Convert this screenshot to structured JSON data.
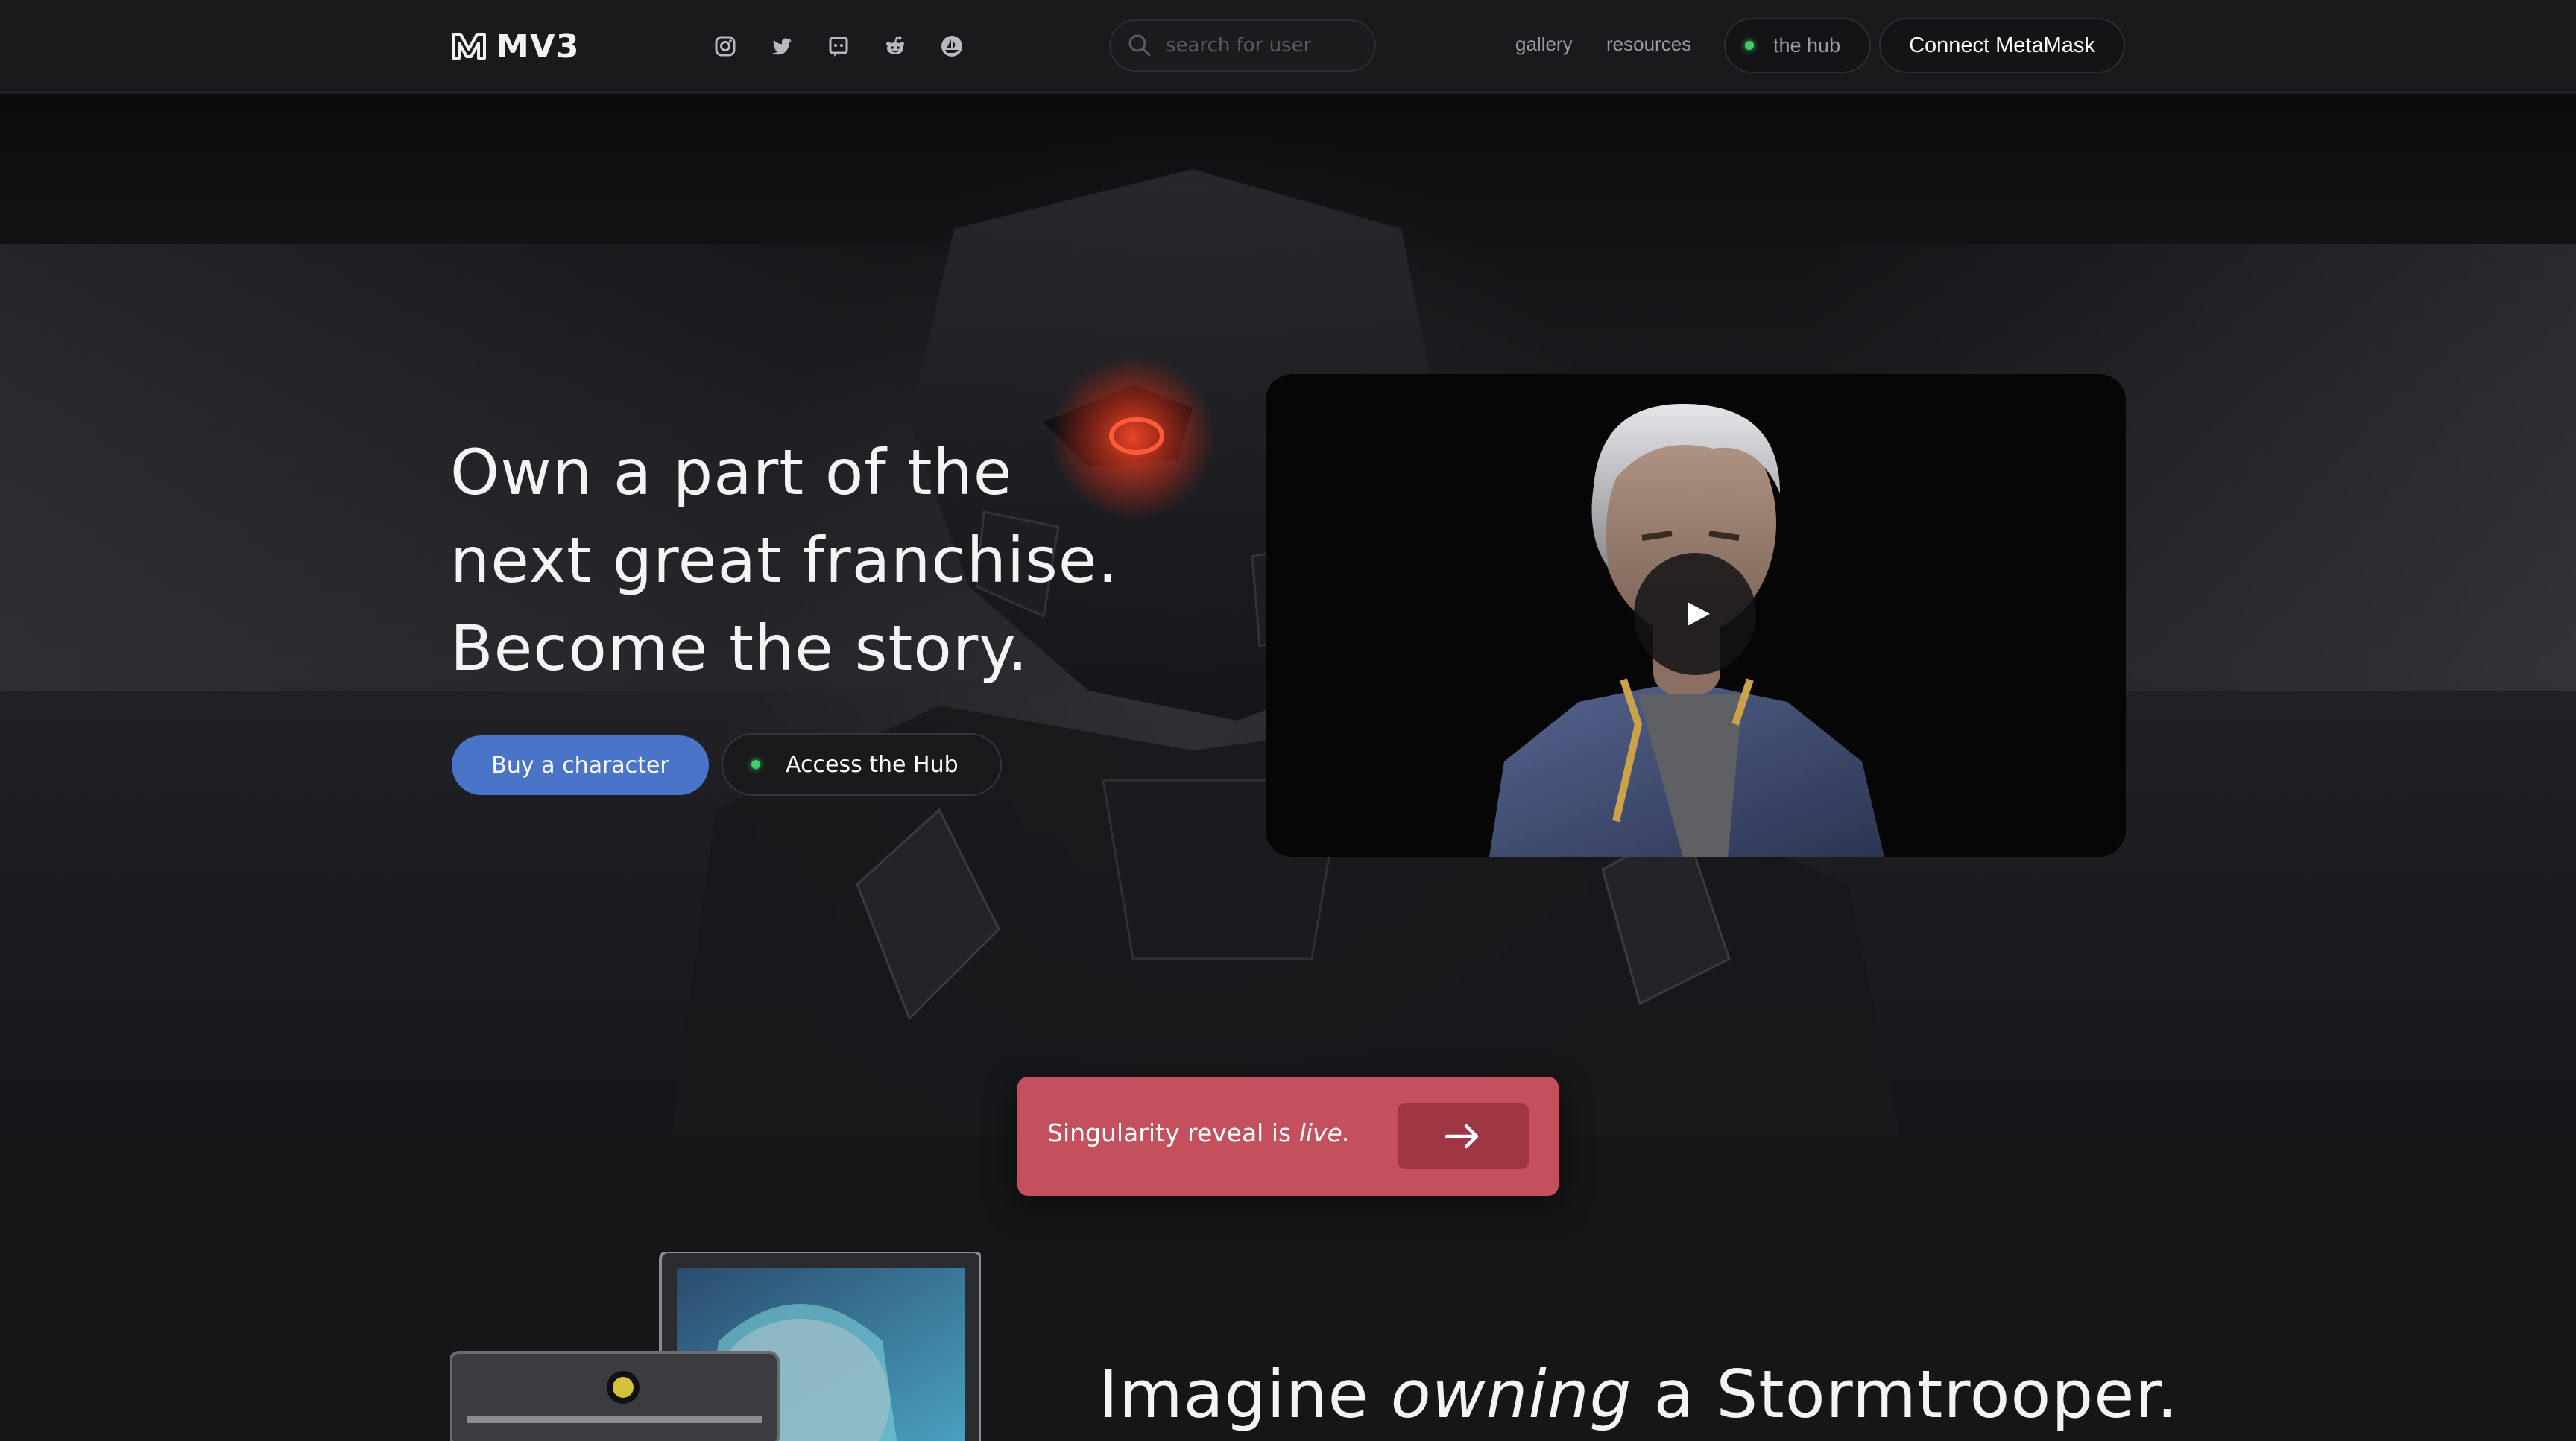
{
  "nav": {
    "logo_text": "MV3",
    "socials": [
      "instagram-icon",
      "twitter-icon",
      "discord-icon",
      "reddit-icon",
      "opensea-icon"
    ],
    "search_placeholder": "search for user",
    "links": {
      "gallery": "gallery",
      "resources": "resources"
    },
    "hub_label": "the hub",
    "connect_label": "Connect MetaMask"
  },
  "hero": {
    "headline_line1": "Own a part of the",
    "headline_line2": "next great franchise.",
    "headline_line3": "Become the story.",
    "buy_label": "Buy a character",
    "hub_label": "Access the Hub"
  },
  "banner": {
    "text_prefix": "Singularity reveal is ",
    "text_emph": "live."
  },
  "section2": {
    "title_prefix": "Imagine ",
    "title_emph": "owning",
    "title_suffix": " a Stormtrooper."
  },
  "colors": {
    "accent_blue": "#4a74c7",
    "banner_red": "#c5505d",
    "banner_button": "#9e3644",
    "status_green": "#3ccf6a"
  }
}
